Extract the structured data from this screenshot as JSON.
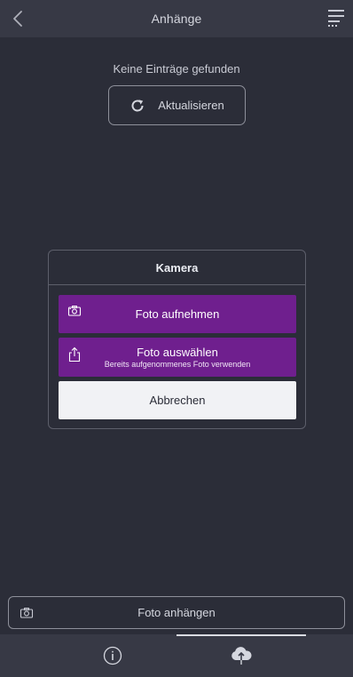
{
  "header": {
    "title": "Anhänge",
    "back_icon": "chevron-left-icon",
    "menu_icon": "menu-lines-icon"
  },
  "main": {
    "empty_text": "Keine Einträge gefunden",
    "refresh_label": "Aktualisieren",
    "refresh_icon": "refresh-icon"
  },
  "dialog": {
    "title": "Kamera",
    "options": [
      {
        "label": "Foto aufnehmen",
        "subtitle": "",
        "icon": "camera-icon"
      },
      {
        "label": "Foto auswählen",
        "subtitle": "Bereits aufgenommenes Foto verwenden",
        "icon": "share-icon"
      }
    ],
    "cancel_label": "Abbrechen"
  },
  "attach": {
    "label": "Foto anhängen",
    "icon": "camera-icon"
  },
  "tabbar": {
    "tabs": [
      {
        "icon": "info-icon",
        "active": false
      },
      {
        "icon": "cloud-upload-icon",
        "active": true
      }
    ]
  },
  "colors": {
    "background": "#2b2d38",
    "bar": "#373945",
    "accent_purple": "#6f1f8e",
    "cancel_bg": "#f1f2f5"
  }
}
